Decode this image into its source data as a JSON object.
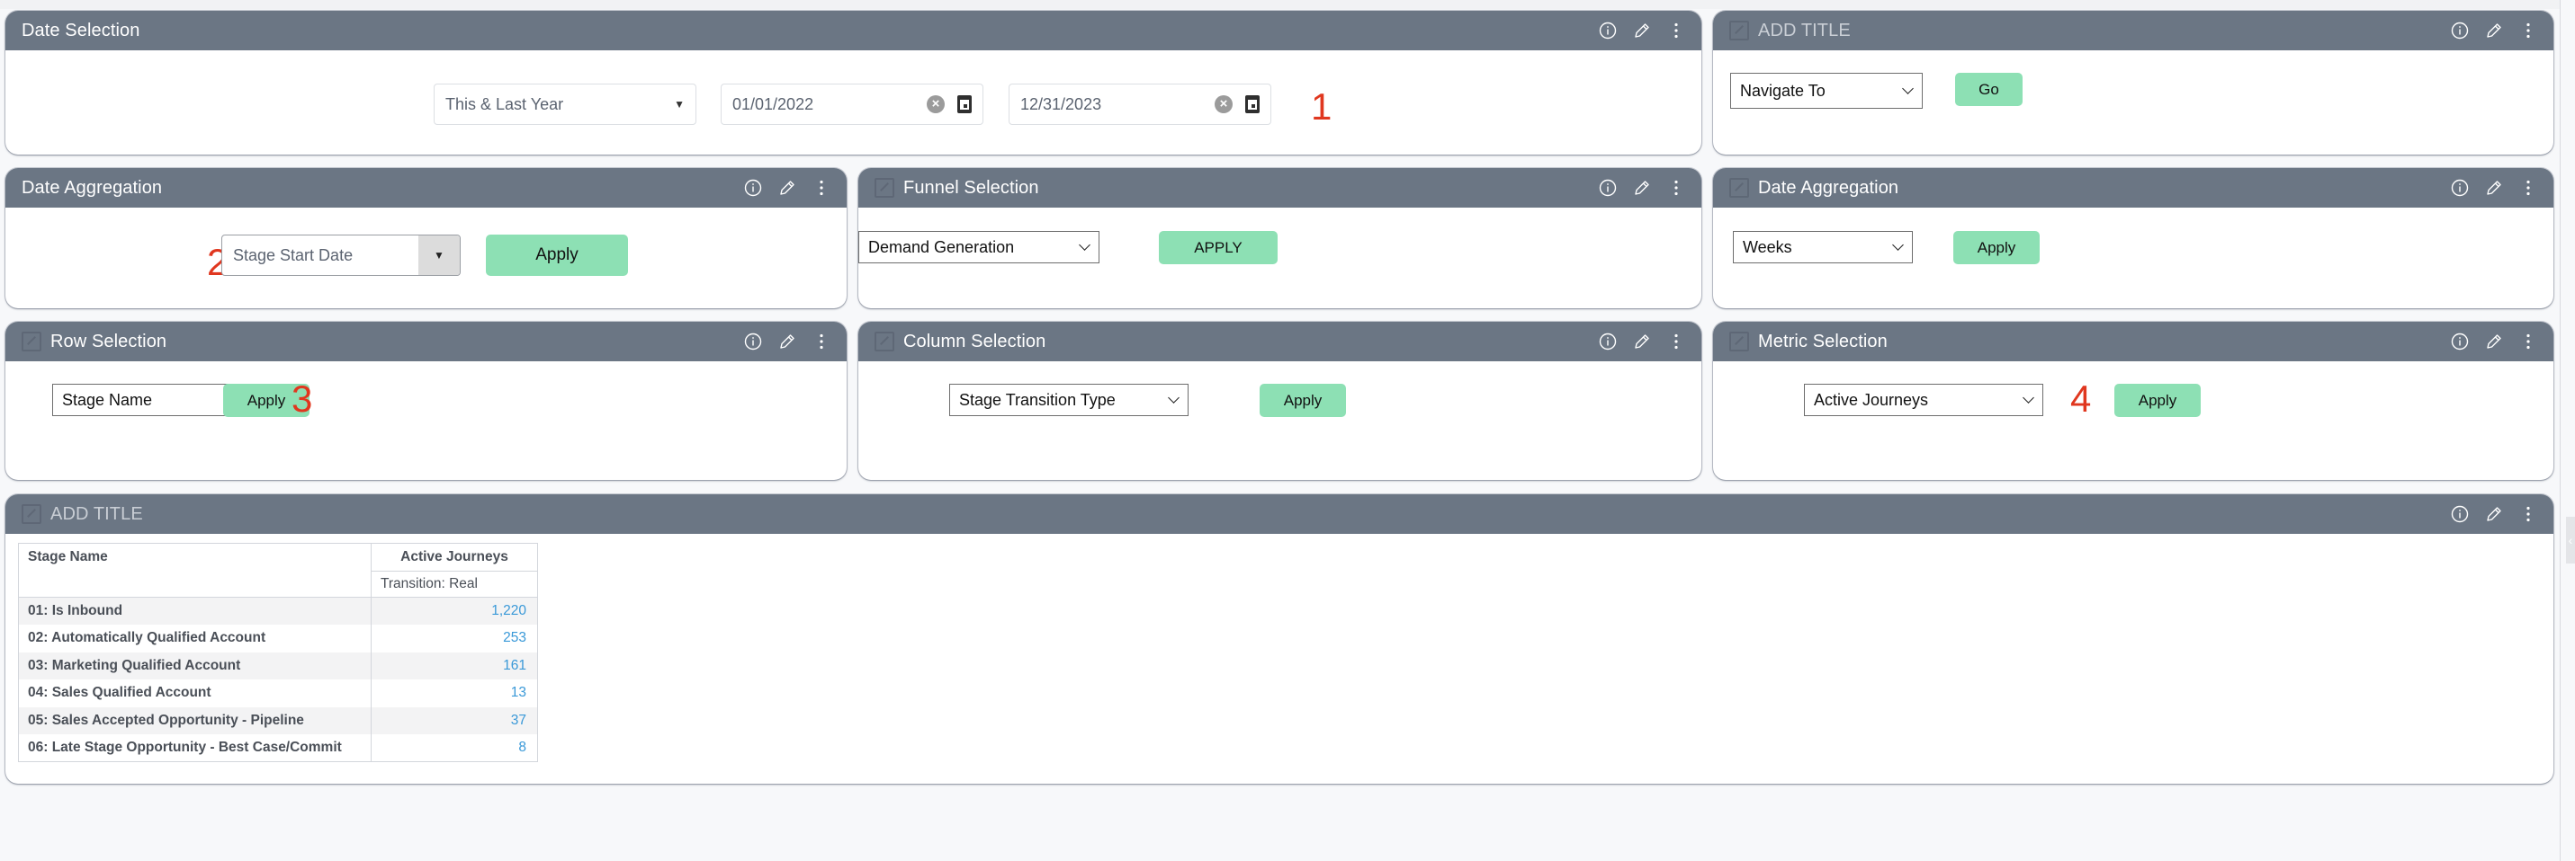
{
  "colors": {
    "header_bg": "#6b7684",
    "apply_button": "#8de0b4",
    "annotation": "#e0371f",
    "value_link": "#3a99d8"
  },
  "header_icons": [
    "info-icon",
    "pencil-icon",
    "more-vertical-icon"
  ],
  "panels": {
    "date_selection": {
      "title": "Date Selection",
      "range_select": "This & Last Year",
      "start_date": "01/01/2022",
      "end_date": "12/31/2023",
      "annotation": "1"
    },
    "navigate": {
      "title": "ADD TITLE",
      "select_value": "Navigate To",
      "go_label": "Go"
    },
    "date_aggregation_left": {
      "title": "Date Aggregation",
      "select_value": "Stage Start Date",
      "apply_label": "Apply",
      "annotation": "2"
    },
    "funnel_selection": {
      "title": "Funnel Selection",
      "select_value": "Demand Generation",
      "apply_label": "APPLY"
    },
    "date_aggregation_right": {
      "title": "Date Aggregation",
      "select_value": "Weeks",
      "apply_label": "Apply"
    },
    "row_selection": {
      "title": "Row Selection",
      "select_value": "Stage Name",
      "apply_label": "Apply",
      "annotation": "3"
    },
    "column_selection": {
      "title": "Column Selection",
      "select_value": "Stage Transition Type",
      "apply_label": "Apply"
    },
    "metric_selection": {
      "title": "Metric Selection",
      "select_value": "Active Journeys",
      "apply_label": "Apply",
      "annotation": "4"
    },
    "table_panel": {
      "title": "ADD TITLE",
      "table": {
        "row_header": "Stage Name",
        "metric_header": "Active Journeys",
        "column_subheader": "Transition: Real",
        "rows": [
          {
            "name": "01: Is Inbound",
            "value": "1,220"
          },
          {
            "name": "02: Automatically Qualified Account",
            "value": "253"
          },
          {
            "name": "03: Marketing Qualified Account",
            "value": "161"
          },
          {
            "name": "04: Sales Qualified Account",
            "value": "13"
          },
          {
            "name": "05: Sales Accepted Opportunity - Pipeline",
            "value": "37"
          },
          {
            "name": "06: Late Stage Opportunity - Best Case/Commit",
            "value": "8"
          }
        ]
      }
    }
  },
  "side_tab": {
    "icon": "chevron-left-icon",
    "glyph": "‹"
  }
}
